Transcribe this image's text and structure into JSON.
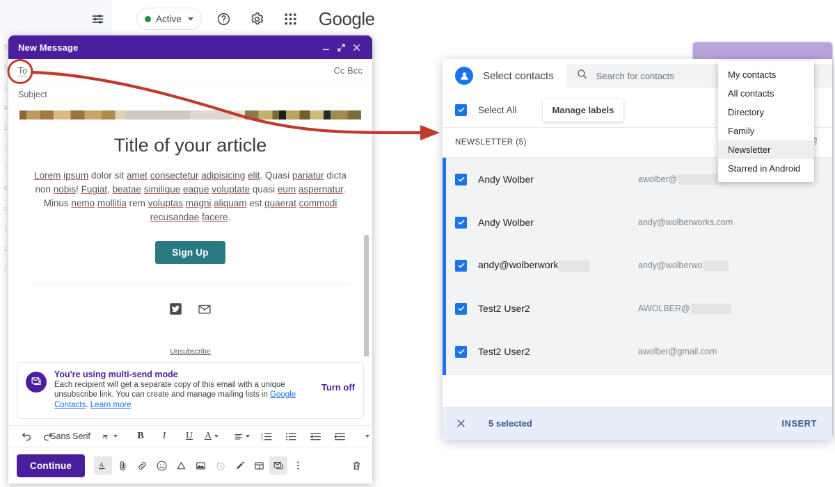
{
  "gmail_topbar": {
    "icons": [
      {
        "name": "tune-icon",
        "glyph": "tune"
      },
      {
        "name": "help-icon",
        "glyph": "help"
      },
      {
        "name": "settings-gear-icon",
        "glyph": "gear"
      },
      {
        "name": "apps-grid-icon",
        "glyph": "grid"
      }
    ],
    "status_label": "Active",
    "status_color": "#1e8e3e",
    "google_wordmark": "Google"
  },
  "left_strip_marks": [
    "3",
    "5",
    "|",
    "4",
    "1",
    "\\",
    "r",
    "4",
    "=",
    ")",
    "1",
    "/"
  ],
  "compose": {
    "title": "New Message",
    "window_color": "#4b1e9e",
    "minimize_label": "–",
    "expand_label": "⤢",
    "close_label": "✕",
    "to_label": "To",
    "cc_bcc_label": "Cc Bcc",
    "subject_label": "Subject",
    "email": {
      "title": "Title of your article",
      "paragraph_parts": [
        {
          "t": "Lorem",
          "u": true
        },
        {
          "t": " ",
          "u": false
        },
        {
          "t": "ipsum",
          "u": true
        },
        {
          "t": " dolor sit ",
          "u": false
        },
        {
          "t": "amet",
          "u": true
        },
        {
          "t": " ",
          "u": false
        },
        {
          "t": "consectetur",
          "u": true
        },
        {
          "t": " ",
          "u": false
        },
        {
          "t": "adipisicing",
          "u": true
        },
        {
          "t": " ",
          "u": false
        },
        {
          "t": "elit",
          "u": true
        },
        {
          "t": ". Quasi ",
          "u": false
        },
        {
          "t": "pariatur",
          "u": true
        },
        {
          "t": " dicta non ",
          "u": false
        },
        {
          "t": "nobis",
          "u": true
        },
        {
          "t": "! ",
          "u": false
        },
        {
          "t": "Fugiat",
          "u": true
        },
        {
          "t": ", ",
          "u": false
        },
        {
          "t": "beatae",
          "u": true
        },
        {
          "t": " ",
          "u": false
        },
        {
          "t": "similique",
          "u": true
        },
        {
          "t": " ",
          "u": false
        },
        {
          "t": "eaque",
          "u": true
        },
        {
          "t": " ",
          "u": false
        },
        {
          "t": "voluptate",
          "u": true
        },
        {
          "t": " quasi ",
          "u": false
        },
        {
          "t": "eum",
          "u": true
        },
        {
          "t": " ",
          "u": false
        },
        {
          "t": "aspernatur",
          "u": true
        },
        {
          "t": ". Minus ",
          "u": false
        },
        {
          "t": "nemo",
          "u": true
        },
        {
          "t": " ",
          "u": false
        },
        {
          "t": "mollitia",
          "u": true
        },
        {
          "t": " rem ",
          "u": false
        },
        {
          "t": "voluptas",
          "u": true
        },
        {
          "t": " ",
          "u": false
        },
        {
          "t": "magni",
          "u": true
        },
        {
          "t": " ",
          "u": false
        },
        {
          "t": "aliquam",
          "u": true
        },
        {
          "t": " est ",
          "u": false
        },
        {
          "t": "quaerat",
          "u": true
        },
        {
          "t": " ",
          "u": false
        },
        {
          "t": "commodi",
          "u": true
        },
        {
          "t": " ",
          "u": false
        },
        {
          "t": "recusandae",
          "u": true
        },
        {
          "t": " ",
          "u": false
        },
        {
          "t": "facere",
          "u": true
        },
        {
          "t": ".",
          "u": false
        }
      ],
      "signup_button": "Sign Up",
      "signup_color": "#2b7a82",
      "social_icons": [
        "twitter-icon",
        "email-icon"
      ],
      "unsubscribe": "Unsubscribe"
    },
    "multisend": {
      "title": "You're using multi-send mode",
      "desc_1": "Each recipient will get a separate copy of this email with a unique unsubscribe link. You can create and manage mailing lists in ",
      "link_1": "Google Contacts",
      "desc_2": ". ",
      "link_2": "Learn more",
      "turn_off_label": "Turn off"
    },
    "format_toolbar": {
      "undo": "↶",
      "redo": "↷",
      "font_name": "Sans Serif",
      "size_label": "tT",
      "bold": "B",
      "italic": "I",
      "underline": "U",
      "text_color": "A",
      "align": "align-icon",
      "numbered_list": "numbered-list-icon",
      "bulleted_list": "bulleted-list-icon",
      "indent_less": "indent-less-icon",
      "indent_more": "indent-more-icon",
      "more": "more-icon"
    },
    "send_toolbar": {
      "continue_label": "Continue",
      "icons": [
        {
          "name": "format-text-icon",
          "active": true
        },
        {
          "name": "attach-file-icon",
          "active": false
        },
        {
          "name": "insert-link-icon",
          "active": false
        },
        {
          "name": "insert-emoji-icon",
          "active": false
        },
        {
          "name": "insert-drive-icon",
          "active": false
        },
        {
          "name": "insert-photo-icon",
          "active": false
        },
        {
          "name": "confidential-mode-icon",
          "active": false
        },
        {
          "name": "insert-signature-icon",
          "active": false
        },
        {
          "name": "layout-icon",
          "active": false
        },
        {
          "name": "multi-send-icon",
          "active": true
        },
        {
          "name": "more-options-icon",
          "active": false
        }
      ],
      "trash": "discard-draft-icon"
    }
  },
  "annotation": {
    "color": "#c0392b",
    "shape": "arrow-from-to-field-to-contacts-dialog"
  },
  "contacts_dialog": {
    "avatar_icon": "person-icon",
    "title": "Select contacts",
    "search_icon": "search-icon",
    "search_placeholder": "Search for contacts",
    "select_all_label": "Select All",
    "select_all_checked": true,
    "manage_labels_label": "Manage labels",
    "group_header": "NEWSLETTER (5)",
    "group_trash_icon": "delete-label-icon",
    "accent_color": "#1a73e8",
    "contacts": [
      {
        "name": "Andy Wolber",
        "email_visible": "awolber@",
        "redact_width": 66,
        "name_redact": 0,
        "checked": true
      },
      {
        "name": "Andy Wolber",
        "email_visible": "andy@wolberworks.com",
        "redact_width": 0,
        "name_redact": 0,
        "checked": true
      },
      {
        "name": "andy@wolberwork",
        "email_visible": "andy@wolberwo",
        "redact_width": 36,
        "name_redact": 44,
        "checked": true
      },
      {
        "name": "Test2 User2",
        "email_visible": "AWOLBER@",
        "redact_width": 58,
        "name_redact": 0,
        "checked": true
      },
      {
        "name": "Test2 User2",
        "email_visible": "awolber@gmail.com",
        "redact_width": 0,
        "name_redact": 0,
        "checked": true
      }
    ],
    "footer": {
      "close_icon": "close-icon",
      "count_label": "5 selected",
      "insert_label": "INSERT"
    }
  },
  "label_dropdown": {
    "items": [
      {
        "label": "My contacts",
        "selected": false
      },
      {
        "label": "All contacts",
        "selected": false
      },
      {
        "label": "Directory",
        "selected": false
      },
      {
        "label": "Family",
        "selected": false
      },
      {
        "label": "Newsletter",
        "selected": true
      },
      {
        "label": "Starred in Android",
        "selected": false
      }
    ]
  }
}
